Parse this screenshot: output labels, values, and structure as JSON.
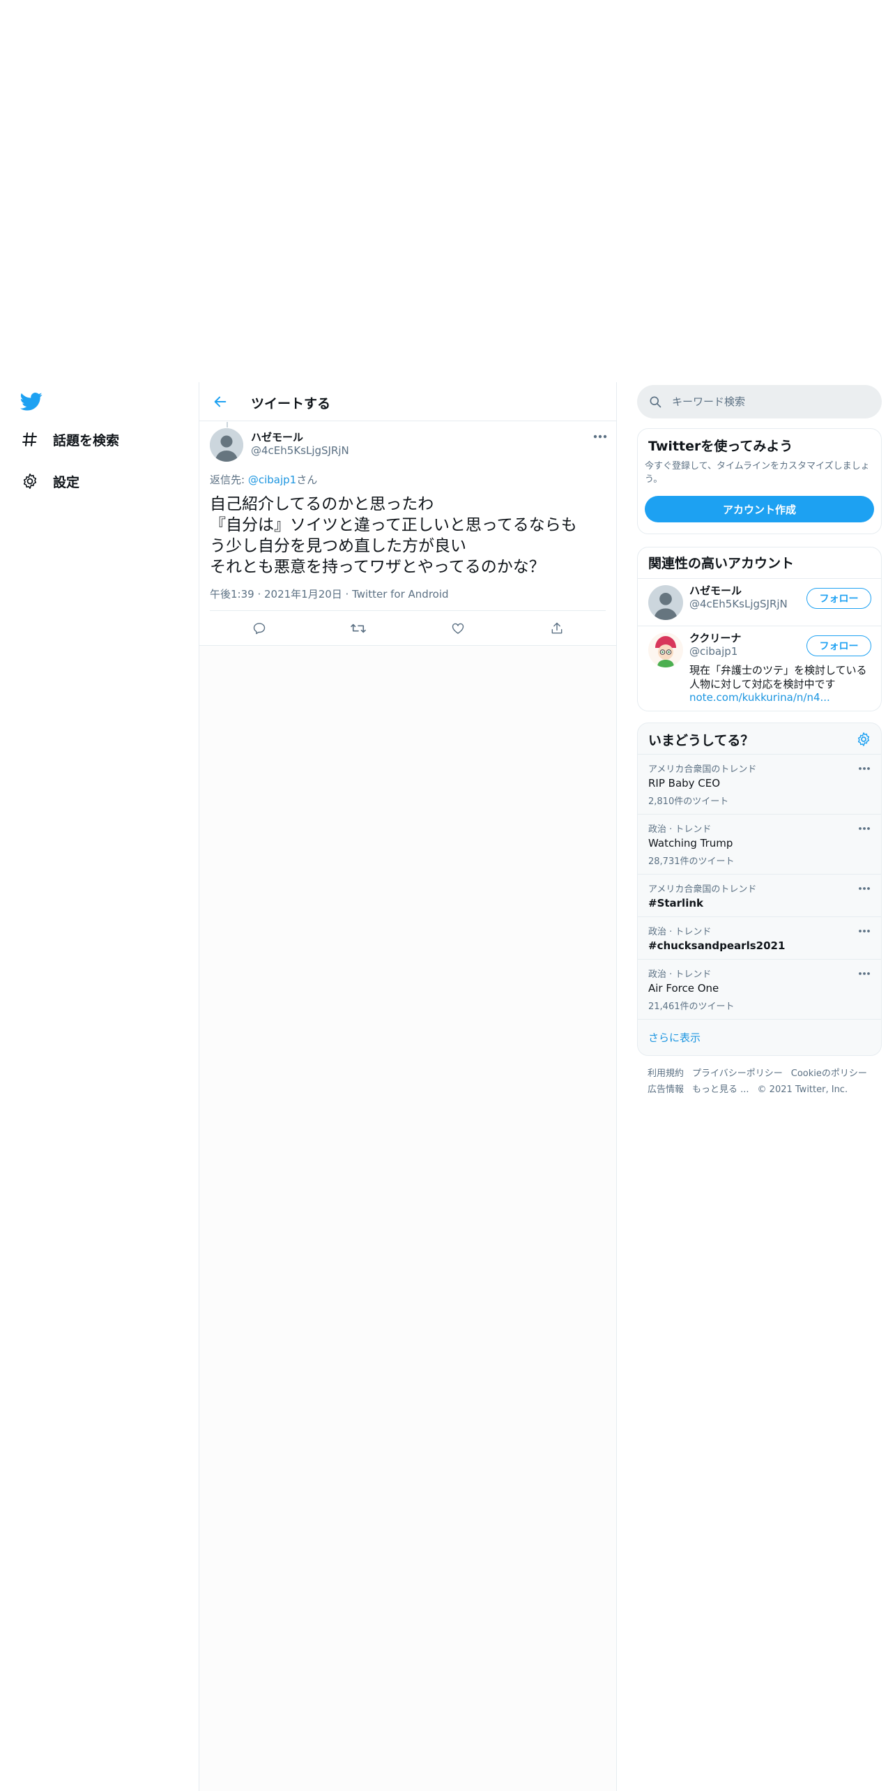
{
  "nav": {
    "explore_label": "話題を検索",
    "settings_label": "設定"
  },
  "header": {
    "title": "ツイートする"
  },
  "tweet": {
    "author_name": "ハゼモール",
    "author_handle": "@4cEh5KsLjgSJRjN",
    "reply_prefix": "返信先: ",
    "reply_user": "@cibajp1",
    "reply_suffix": "さん",
    "text_lines": [
      "自己紹介してるのかと思ったわ",
      "『自分は』ソイツと違って正しいと思ってるならも",
      "う少し自分を見つめ直した方が良い",
      "それとも悪意を持ってワザとやってるのかな？"
    ],
    "meta": "午後1:39 · 2021年1月20日 · Twitter for Android"
  },
  "search": {
    "placeholder": "キーワード検索"
  },
  "signup": {
    "title": "Twitterを使ってみよう",
    "desc": "今すぐ登録して、タイムラインをカスタマイズしましょう。",
    "button": "アカウント作成"
  },
  "relevant": {
    "title": "関連性の高いアカウント",
    "follow_label": "フォロー",
    "accounts": [
      {
        "name": "ハゼモール",
        "handle": "@4cEh5KsLjgSJRjN"
      },
      {
        "name": "ククリーナ",
        "handle": "@cibajp1",
        "bio_lines": [
          "現在「弁護士のツテ」を検討している",
          "人物に対して対応を検討中です"
        ],
        "link": "note.com/kukkurina/n/n4..."
      }
    ]
  },
  "trends": {
    "title": "いまどうしてる？",
    "items": [
      {
        "context": "アメリカ合衆国のトレンド",
        "name": "RIP Baby CEO",
        "count": "2,810件のツイート"
      },
      {
        "context": "政治 · トレンド",
        "name": "Watching Trump",
        "count": "28,731件のツイート"
      },
      {
        "context": "アメリカ合衆国のトレンド",
        "name": "#Starlink",
        "count": ""
      },
      {
        "context": "政治 · トレンド",
        "name": "#chucksandpearls2021",
        "count": ""
      },
      {
        "context": "政治 · トレンド",
        "name": "Air Force One",
        "count": "21,461件のツイート"
      }
    ],
    "show_more": "さらに表示"
  },
  "footer": {
    "terms": "利用規約",
    "privacy": "プライバシーポリシー",
    "cookie": "Cookieのポリシー",
    "ads": "広告情報",
    "more": "もっと見る ...",
    "copyright": "© 2021 Twitter, Inc."
  },
  "colors": {
    "accent": "#1da1f2",
    "link": "#1b95e0",
    "secondary_text": "#5b7083"
  }
}
